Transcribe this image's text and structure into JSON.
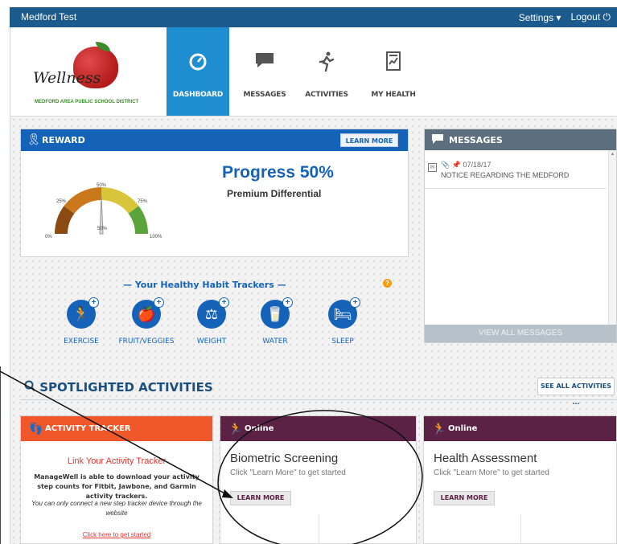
{
  "topbar": {
    "title": "Medford Test",
    "settings": "Settings",
    "logout": "Logout"
  },
  "logo": {
    "script": "Wellness",
    "district": "MEDFORD AREA PUBLIC SCHOOL DISTRICT"
  },
  "nav": [
    {
      "label": "DASHBOARD",
      "icon": "speedometer-icon"
    },
    {
      "label": "MESSAGES",
      "icon": "chat-icon"
    },
    {
      "label": "ACTIVITIES",
      "icon": "runner-icon"
    },
    {
      "label": "MY HEALTH",
      "icon": "chart-report-icon"
    }
  ],
  "reward": {
    "title": "REWARD",
    "learn_more": "LEARN MORE",
    "progress_title": "Progress 50%",
    "progress_value": 0.5,
    "subtitle": "Premium Differential",
    "ticks": [
      "0%",
      "25%",
      "50%",
      "75%",
      "100%"
    ],
    "needle_label": "50%"
  },
  "habits": {
    "title": "— Your Healthy Habit Trackers —",
    "help": "?",
    "items": [
      {
        "label": "EXERCISE",
        "icon": "exercise-icon"
      },
      {
        "label": "FRUIT/VEGGIES",
        "icon": "apple-icon"
      },
      {
        "label": "WEIGHT",
        "icon": "scale-icon"
      },
      {
        "label": "WATER",
        "icon": "water-icon"
      },
      {
        "label": "SLEEP",
        "icon": "bed-icon"
      }
    ]
  },
  "messages": {
    "title": "MESSAGES",
    "items": [
      {
        "date": "07/18/17",
        "subject": "NOTICE REGARDING THE MEDFORD"
      }
    ],
    "view_all": "VIEW ALL MESSAGES"
  },
  "spotlight": {
    "title": "SPOTLIGHTED ACTIVITIES",
    "see_all": "SEE ALL ACTIVITIES ..."
  },
  "tracker_card": {
    "title": "ACTIVITY TRACKER",
    "link": "Link Your Activity Tracker",
    "body": "ManageWell is able to download your activity step counts for Fitbit, Jawbone, and Garmin activity trackers.",
    "note": "You can only connect a new step tracker device through the website",
    "click": "Click here to get started"
  },
  "bio_card": {
    "status": "Online",
    "title": "Biometric Screening",
    "subtitle": "Click \"Learn More\" to get started",
    "button": "LEARN MORE"
  },
  "ha_card": {
    "status": "Online",
    "title": "Health Assessment",
    "subtitle": "Click \"Learn More\" to get started",
    "button": "LEARN MORE"
  }
}
